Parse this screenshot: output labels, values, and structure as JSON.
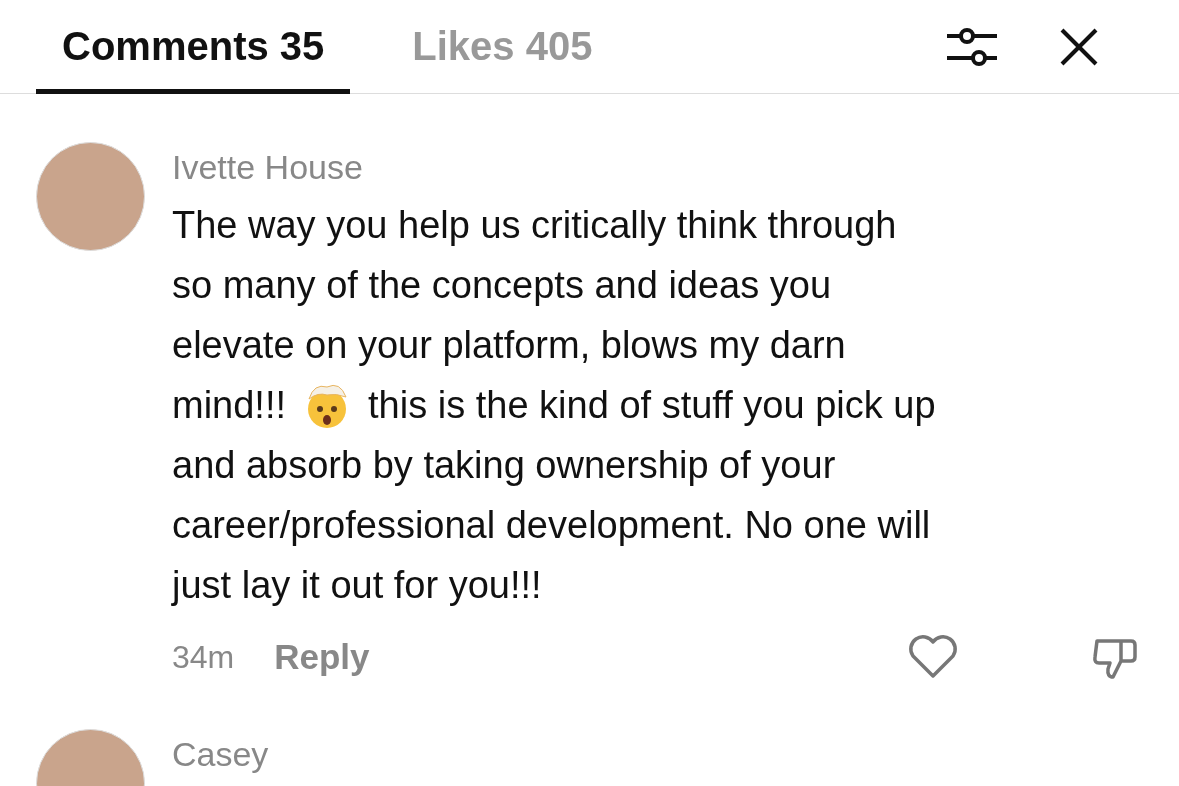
{
  "tabs": [
    {
      "label": "Comments 35",
      "selected": true
    },
    {
      "label": "Likes 405",
      "selected": false
    }
  ],
  "comments": [
    {
      "name": "Ivette House",
      "lines": [
        {
          "text": "The way you help us critically think through"
        },
        {
          "text": "so many of the concepts and ideas you"
        },
        {
          "text": "elevate on your platform, blows my darn"
        },
        {
          "text": "mind!!!",
          "emoji": true,
          "text_after": "this is the kind of stuff you pick up"
        },
        {
          "text": "and absorb by taking ownership of your"
        },
        {
          "text": "career/professional development. No one will"
        },
        {
          "text": "just lay it out for you!!!"
        }
      ],
      "time": "34m",
      "reply": "Reply",
      "liked": false
    },
    {
      "name": "Casey"
    }
  ]
}
